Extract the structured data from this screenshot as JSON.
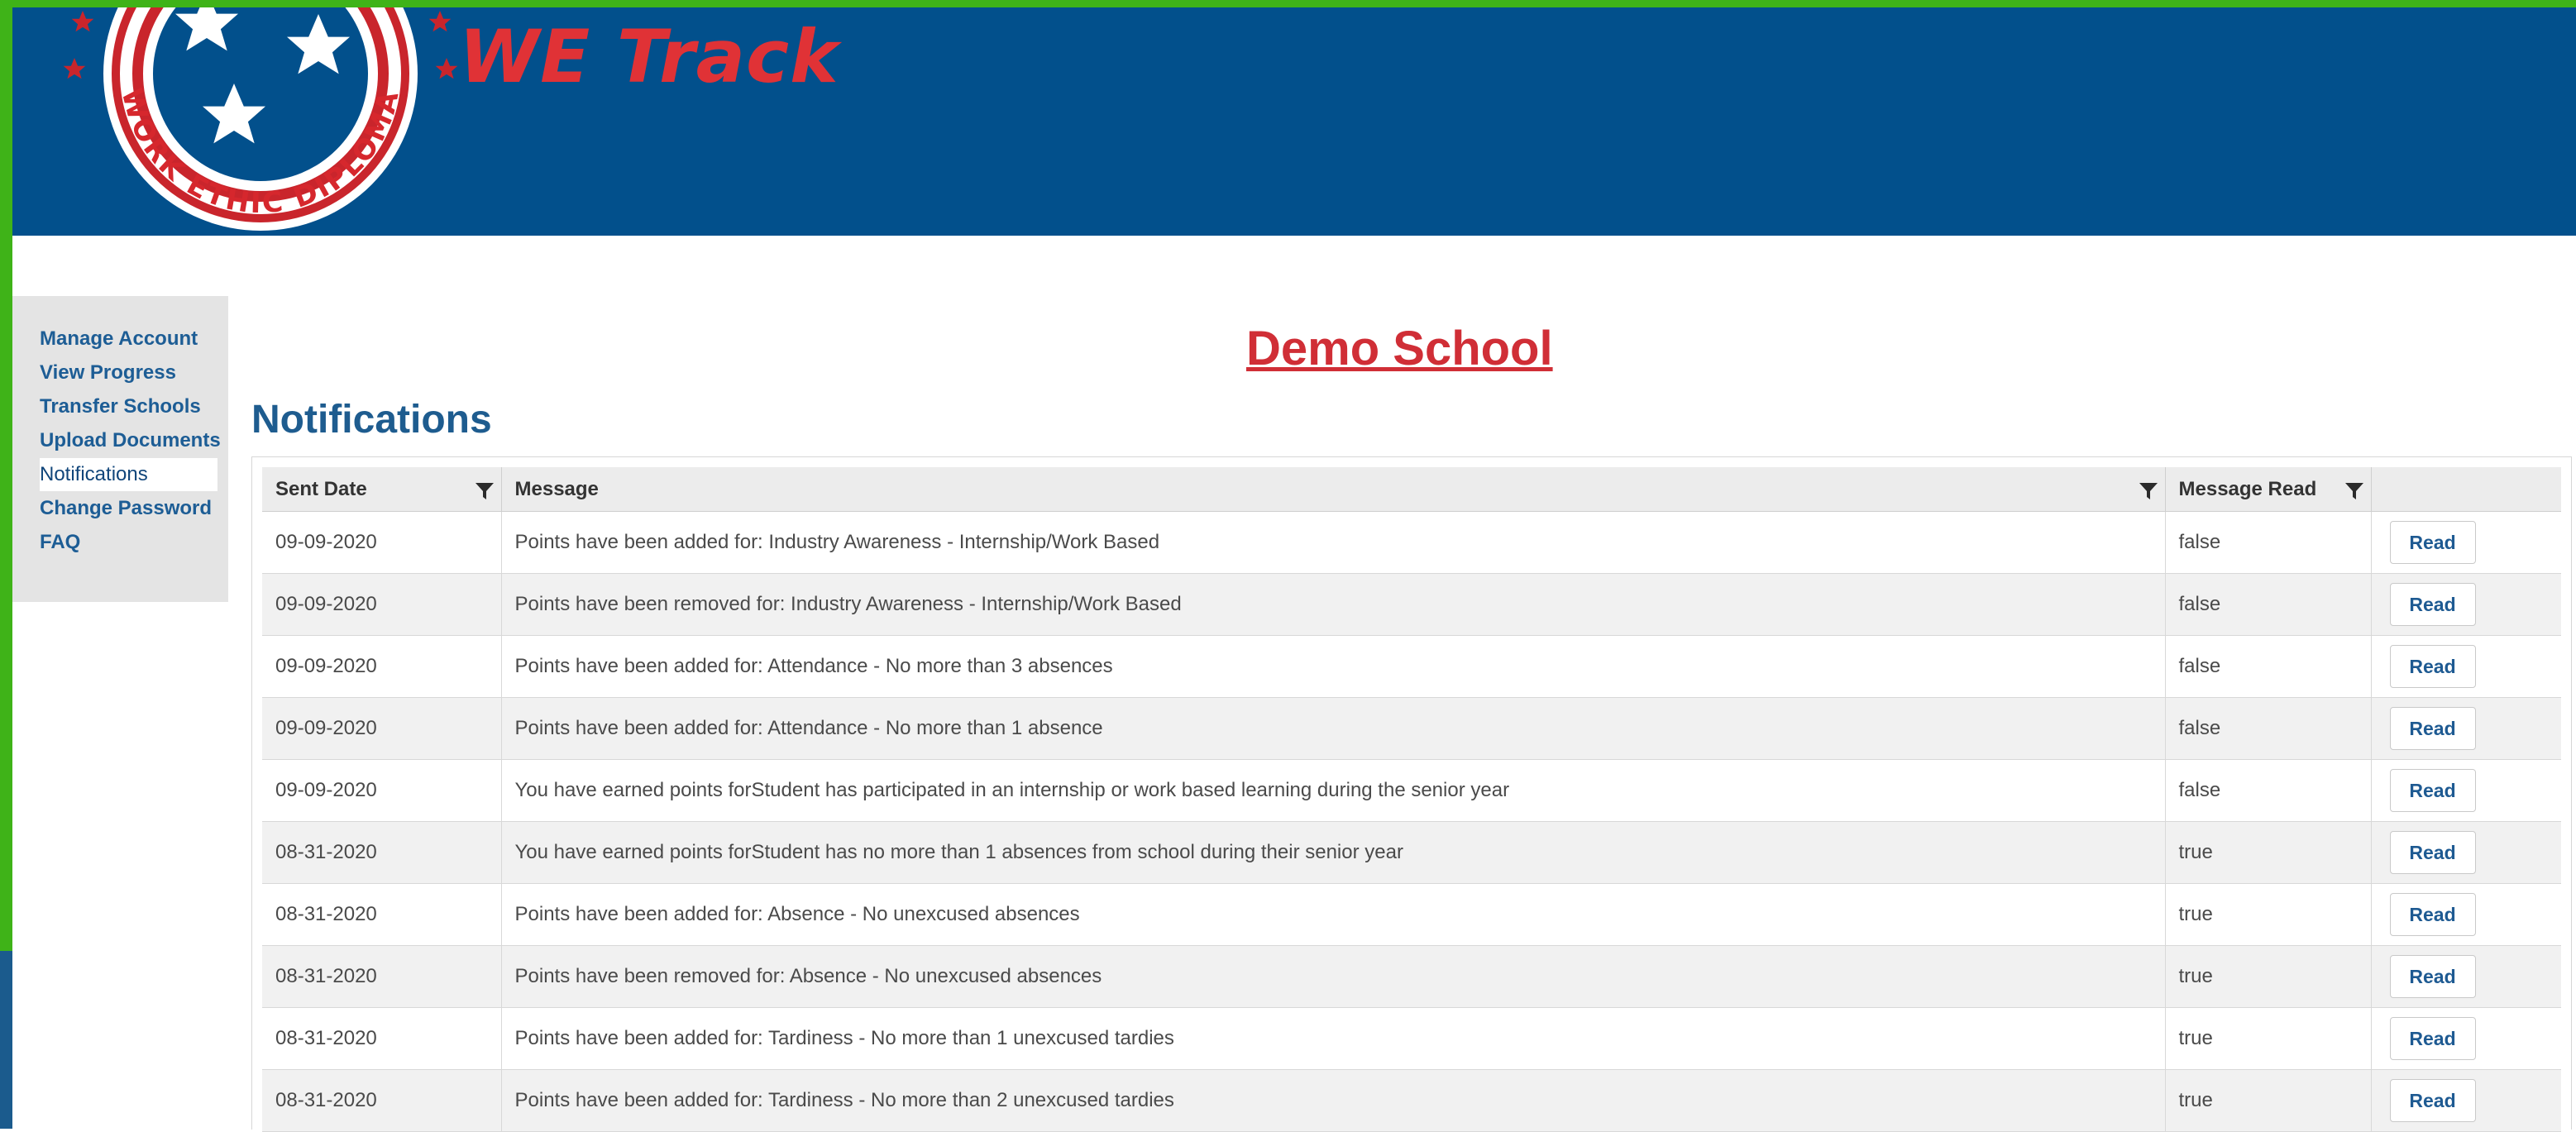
{
  "header": {
    "app_title": "WE Track",
    "logo_text": "WORK ETHIC DIPLOMA"
  },
  "sidebar": {
    "items": [
      {
        "label": "Manage Account"
      },
      {
        "label": "View Progress"
      },
      {
        "label": "Transfer Schools"
      },
      {
        "label": "Upload Documents"
      },
      {
        "label": "Notifications",
        "active": true
      },
      {
        "label": "Change Password"
      },
      {
        "label": "FAQ"
      }
    ]
  },
  "main": {
    "school_name": "Demo School",
    "page_title": "Notifications"
  },
  "grid": {
    "columns": [
      "Sent Date",
      "Message",
      "Message Read",
      ""
    ],
    "button_label": "Read",
    "rows": [
      {
        "date": "09-09-2020",
        "message": "Points have been added for: Industry Awareness - Internship/Work Based",
        "read": "false"
      },
      {
        "date": "09-09-2020",
        "message": "Points have been removed for: Industry Awareness - Internship/Work Based",
        "read": "false"
      },
      {
        "date": "09-09-2020",
        "message": "Points have been added for: Attendance - No more than 3 absences",
        "read": "false"
      },
      {
        "date": "09-09-2020",
        "message": "Points have been added for: Attendance - No more than 1 absence",
        "read": "false"
      },
      {
        "date": "09-09-2020",
        "message": "You have earned points forStudent has participated in an internship or work based learning during the senior year",
        "read": "false"
      },
      {
        "date": "08-31-2020",
        "message": "You have earned points forStudent has no more than 1 absences from school during their senior year",
        "read": "true"
      },
      {
        "date": "08-31-2020",
        "message": "Points have been added for: Absence - No unexcused absences",
        "read": "true"
      },
      {
        "date": "08-31-2020",
        "message": "Points have been removed for: Absence - No unexcused absences",
        "read": "true"
      },
      {
        "date": "08-31-2020",
        "message": "Points have been added for: Tardiness - No more than 1 unexcused tardies",
        "read": "true"
      },
      {
        "date": "08-31-2020",
        "message": "Points have been added for: Tardiness - No more than 2 unexcused tardies",
        "read": "true"
      }
    ]
  },
  "colors": {
    "header_blue": "#02508c",
    "accent_green": "#3fb318",
    "brand_red": "#d02e36",
    "link_blue": "#1d5d95"
  }
}
